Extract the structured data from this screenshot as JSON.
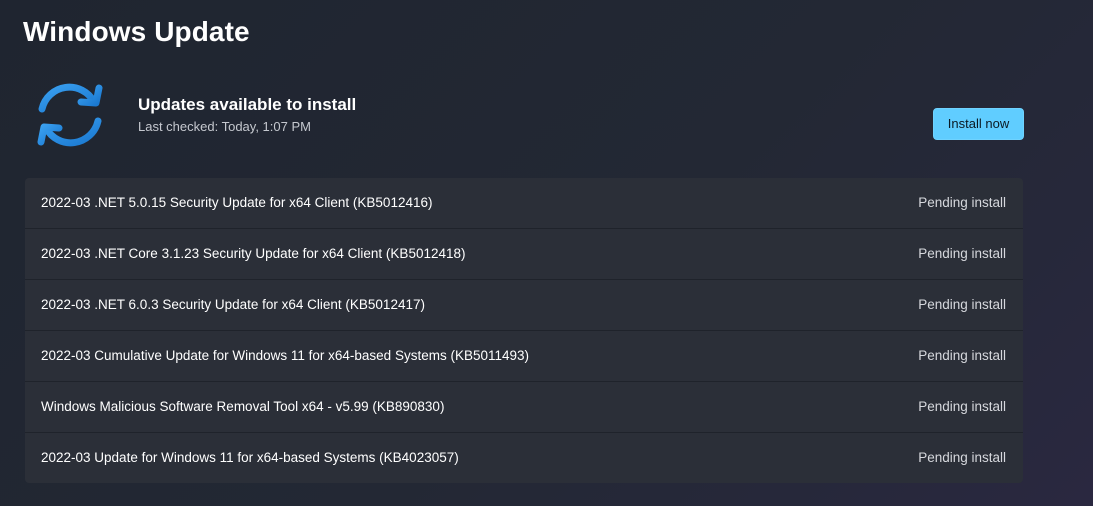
{
  "page": {
    "title": "Windows Update"
  },
  "status": {
    "icon": "sync-icon",
    "title": "Updates available to install",
    "last_checked": "Last checked: Today, 1:07 PM",
    "install_button": "Install now"
  },
  "colors": {
    "accent": "#60cdff",
    "icon_blue": "#2f8fe0"
  },
  "updates": [
    {
      "name": "2022-03 .NET 5.0.15 Security Update for x64 Client (KB5012416)",
      "status": "Pending install"
    },
    {
      "name": "2022-03 .NET Core 3.1.23 Security Update for x64 Client (KB5012418)",
      "status": "Pending install"
    },
    {
      "name": "2022-03 .NET 6.0.3 Security Update for x64 Client (KB5012417)",
      "status": "Pending install"
    },
    {
      "name": "2022-03 Cumulative Update for Windows 11 for x64-based Systems (KB5011493)",
      "status": "Pending install"
    },
    {
      "name": "Windows Malicious Software Removal Tool x64 - v5.99 (KB890830)",
      "status": "Pending install"
    },
    {
      "name": "2022-03 Update for Windows 11 for x64-based Systems (KB4023057)",
      "status": "Pending install"
    }
  ]
}
